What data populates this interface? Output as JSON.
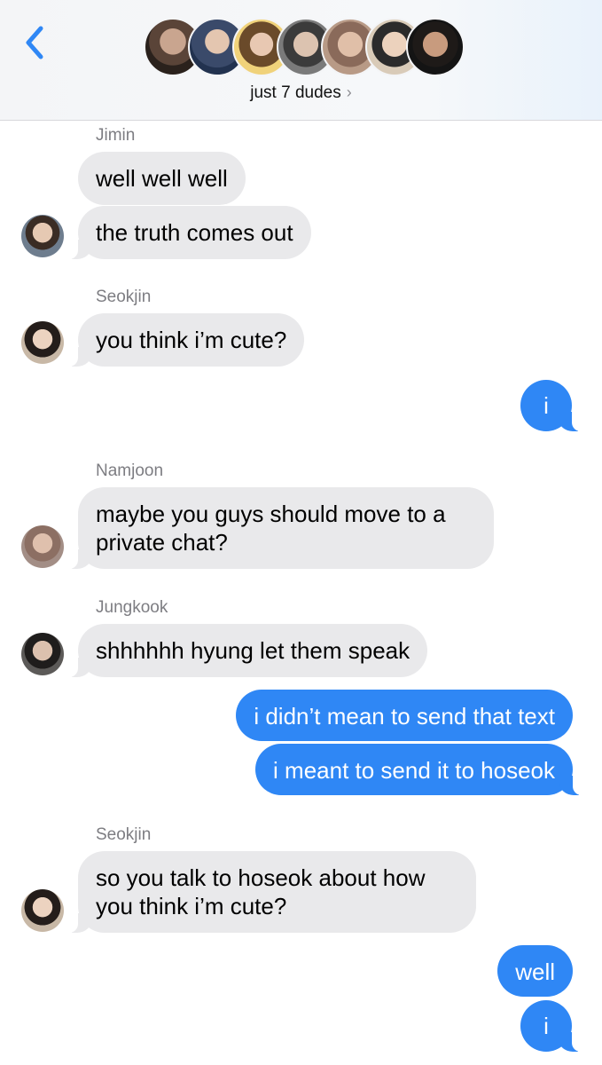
{
  "header": {
    "group_name": "just 7 dudes",
    "chevron": "›",
    "back_icon": "chevron-left-icon",
    "avatar_count": 7
  },
  "messages": [
    {
      "sender": "Jimin",
      "text": "well well well",
      "direction": "incoming"
    },
    {
      "text": "the truth comes out",
      "direction": "incoming"
    },
    {
      "sender": "Seokjin",
      "text": "you think i’m cute?",
      "direction": "incoming"
    },
    {
      "text": "i",
      "direction": "outgoing"
    },
    {
      "sender": "Namjoon",
      "text": "maybe you guys should move to a private chat?",
      "direction": "incoming"
    },
    {
      "sender": "Jungkook",
      "text": "shhhhhh hyung let them speak",
      "direction": "incoming"
    },
    {
      "text": "i didn’t mean to send that text",
      "direction": "outgoing"
    },
    {
      "text": "i meant to send it to hoseok",
      "direction": "outgoing"
    },
    {
      "sender": "Seokjin",
      "text": "so you talk to hoseok about how you think i’m cute?",
      "direction": "incoming"
    },
    {
      "text": "well",
      "direction": "outgoing"
    },
    {
      "text": "i",
      "direction": "outgoing"
    }
  ],
  "colors": {
    "outgoing_bubble": "#2f87f5",
    "incoming_bubble": "#e9e9eb",
    "accent": "#2f87f5"
  }
}
